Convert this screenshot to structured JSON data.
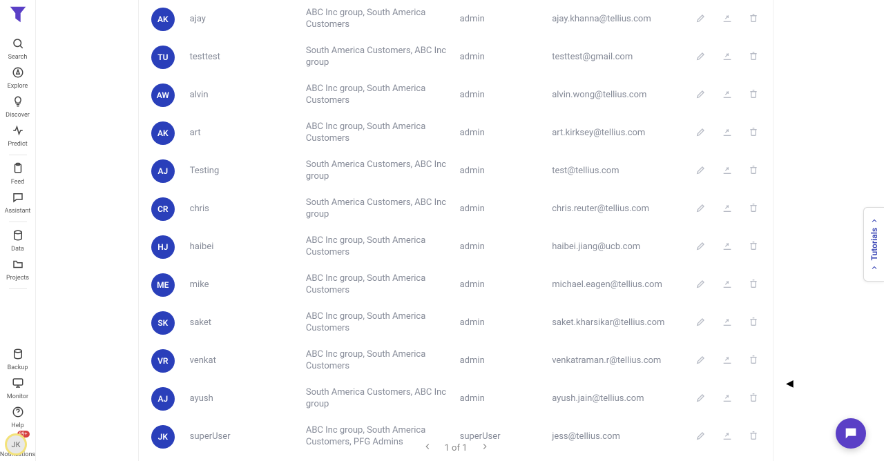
{
  "sidebar": {
    "items": [
      {
        "label": "Search",
        "icon": "search-icon"
      },
      {
        "label": "Explore",
        "icon": "compass-icon"
      },
      {
        "label": "Discover",
        "icon": "bulb-icon"
      },
      {
        "label": "Predict",
        "icon": "pulse-icon"
      }
    ],
    "items2": [
      {
        "label": "Feed",
        "icon": "clipboard-icon"
      },
      {
        "label": "Assistant",
        "icon": "chat-icon"
      }
    ],
    "items3": [
      {
        "label": "Data",
        "icon": "database-icon"
      },
      {
        "label": "Projects",
        "icon": "folder-icon"
      }
    ],
    "items4": [
      {
        "label": "Backup",
        "icon": "database-icon"
      },
      {
        "label": "Monitor",
        "icon": "monitor-icon"
      },
      {
        "label": "Help",
        "icon": "help-icon"
      },
      {
        "label": "Notifications",
        "icon": "bell-icon",
        "badge": "99+"
      }
    ],
    "footer_avatar": "JK"
  },
  "tutorials": {
    "label": "Tutorials"
  },
  "pager": {
    "text": "1 of 1"
  },
  "table": {
    "rows": [
      {
        "avatar": "AK",
        "name": "ajay",
        "group": "ABC Inc group, South America Customers",
        "role": "admin",
        "email": "ajay.khanna@tellius.com"
      },
      {
        "avatar": "TU",
        "name": "testtest",
        "group": "South America Customers, ABC Inc group",
        "role": "admin",
        "email": "testtest@gmail.com"
      },
      {
        "avatar": "AW",
        "name": "alvin",
        "group": "ABC Inc group, South America Customers",
        "role": "admin",
        "email": "alvin.wong@tellius.com"
      },
      {
        "avatar": "AK",
        "name": "art",
        "group": "ABC Inc group, South America Customers",
        "role": "admin",
        "email": "art.kirksey@tellius.com"
      },
      {
        "avatar": "AJ",
        "name": "Testing",
        "group": "South America Customers, ABC Inc group",
        "role": "admin",
        "email": "test@tellius.com"
      },
      {
        "avatar": "CR",
        "name": "chris",
        "group": "South America Customers, ABC Inc group",
        "role": "admin",
        "email": "chris.reuter@tellius.com"
      },
      {
        "avatar": "HJ",
        "name": "haibei",
        "group": "ABC Inc group, South America Customers",
        "role": "admin",
        "email": "haibei.jiang@ucb.com"
      },
      {
        "avatar": "ME",
        "name": "mike",
        "group": "ABC Inc group, South America Customers",
        "role": "admin",
        "email": "michael.eagen@tellius.com"
      },
      {
        "avatar": "SK",
        "name": "saket",
        "group": "ABC Inc group, South America Customers",
        "role": "admin",
        "email": "saket.kharsikar@tellius.com"
      },
      {
        "avatar": "VR",
        "name": "venkat",
        "group": "ABC Inc group, South America Customers",
        "role": "admin",
        "email": "venkatraman.r@tellius.com"
      },
      {
        "avatar": "AJ",
        "name": "ayush",
        "group": "South America Customers, ABC Inc group",
        "role": "admin",
        "email": "ayush.jain@tellius.com"
      },
      {
        "avatar": "JK",
        "name": "superUser",
        "group": "ABC Inc group, South America Customers, PFG Admins",
        "role": "superUser",
        "email": "jess@tellius.com"
      }
    ]
  }
}
